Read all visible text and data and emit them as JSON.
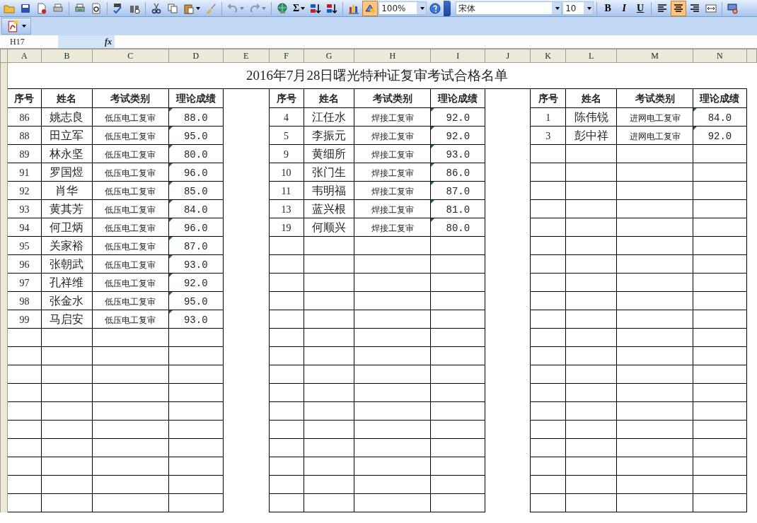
{
  "toolbar": [
    {
      "kind": "icon",
      "selected": false,
      "disabled": false,
      "dropdown": false
    },
    {
      "kind": "icon",
      "selected": false,
      "disabled": false,
      "dropdown": false
    },
    {
      "kind": "icon",
      "selected": false,
      "disabled": false,
      "dropdown": false
    },
    {
      "kind": "icon",
      "selected": false,
      "disabled": false,
      "dropdown": false
    },
    {
      "kind": "separator"
    },
    {
      "kind": "icon",
      "selected": false,
      "disabled": false,
      "dropdown": false
    },
    {
      "kind": "icon",
      "selected": false,
      "disabled": false,
      "dropdown": false
    },
    {
      "kind": "separator"
    },
    {
      "kind": "icon",
      "selected": false,
      "disabled": false,
      "dropdown": false
    },
    {
      "kind": "icon",
      "selected": false,
      "disabled": false,
      "dropdown": false
    },
    {
      "kind": "separator"
    },
    {
      "kind": "icon",
      "selected": false,
      "disabled": false,
      "dropdown": false
    },
    {
      "kind": "icon",
      "selected": false,
      "disabled": false,
      "dropdown": false
    },
    {
      "kind": "icon",
      "selected": false,
      "disabled": false,
      "dropdown": true
    },
    {
      "kind": "icon",
      "selected": false,
      "disabled": false,
      "dropdown": false
    },
    {
      "kind": "separator"
    },
    {
      "kind": "icon",
      "selected": false,
      "disabled": true,
      "dropdown": true
    },
    {
      "kind": "icon",
      "selected": false,
      "disabled": true,
      "dropdown": true
    },
    {
      "kind": "separator"
    },
    {
      "kind": "icon",
      "selected": false,
      "disabled": false,
      "dropdown": false
    },
    {
      "kind": "text",
      "text": "Σ",
      "bold": true,
      "italic": false,
      "underline": false,
      "selected": false,
      "disabled": false,
      "dropdown": true
    },
    {
      "kind": "icon",
      "selected": false,
      "disabled": false,
      "dropdown": false
    },
    {
      "kind": "icon",
      "selected": false,
      "disabled": false,
      "dropdown": false
    },
    {
      "kind": "separator"
    },
    {
      "kind": "icon",
      "selected": false,
      "disabled": false,
      "dropdown": false
    },
    {
      "kind": "icon",
      "selected": true,
      "disabled": false,
      "dropdown": false
    },
    {
      "kind": "combo",
      "value": "100%"
    },
    {
      "kind": "icon",
      "selected": false,
      "disabled": false,
      "dropdown": false
    },
    {
      "kind": "grip"
    },
    {
      "kind": "font_combo",
      "value": "宋体"
    },
    {
      "kind": "size_combo",
      "value": "10"
    },
    {
      "kind": "separator"
    },
    {
      "kind": "text",
      "text": "B",
      "bold": true,
      "italic": false,
      "underline": false,
      "selected": false,
      "disabled": false,
      "dropdown": false
    },
    {
      "kind": "text",
      "text": "I",
      "bold": true,
      "italic": true,
      "underline": false,
      "selected": false,
      "disabled": false,
      "dropdown": false
    },
    {
      "kind": "text",
      "text": "U",
      "bold": true,
      "italic": false,
      "underline": true,
      "selected": false,
      "disabled": false,
      "dropdown": false
    },
    {
      "kind": "separator"
    },
    {
      "kind": "icon",
      "selected": false,
      "disabled": false,
      "dropdown": false
    },
    {
      "kind": "icon",
      "selected": true,
      "disabled": false,
      "dropdown": false
    },
    {
      "kind": "icon",
      "selected": false,
      "disabled": false,
      "dropdown": false
    },
    {
      "kind": "icon",
      "selected": false,
      "disabled": false,
      "dropdown": false
    },
    {
      "kind": "separator"
    },
    {
      "kind": "icon",
      "selected": false,
      "disabled": false,
      "dropdown": false
    }
  ],
  "formula_bar": {
    "name_box": "H17",
    "function_label": "fx"
  },
  "column_headers": [
    "A",
    "B",
    "C",
    "D",
    "E",
    "F",
    "G",
    "H",
    "I",
    "J",
    "K",
    "L",
    "M",
    "N"
  ],
  "title": "2016年7月28日曙光特种证复审考试合格名单",
  "sections": [
    {
      "columns": [
        "序号",
        "姓名",
        "考试类别",
        "理论成绩"
      ],
      "rows": [
        {
          "no": "86",
          "name": "姚志良",
          "category": "低压电工复审",
          "score": "88.0",
          "flag": true
        },
        {
          "no": "88",
          "name": "田立军",
          "category": "低压电工复审",
          "score": "95.0",
          "flag": true
        },
        {
          "no": "89",
          "name": "林永坚",
          "category": "低压电工复审",
          "score": "80.0",
          "flag": true
        },
        {
          "no": "91",
          "name": "罗国煜",
          "category": "低压电工复审",
          "score": "96.0",
          "flag": true
        },
        {
          "no": "92",
          "name": "肖华",
          "category": "低压电工复审",
          "score": "85.0",
          "flag": true
        },
        {
          "no": "93",
          "name": "黄其芳",
          "category": "低压电工复审",
          "score": "84.0",
          "flag": true
        },
        {
          "no": "94",
          "name": "何卫炳",
          "category": "低压电工复审",
          "score": "96.0",
          "flag": true
        },
        {
          "no": "95",
          "name": "关家裕",
          "category": "低压电工复审",
          "score": "87.0",
          "flag": true
        },
        {
          "no": "96",
          "name": "张朝武",
          "category": "低压电工复审",
          "score": "93.0",
          "flag": true
        },
        {
          "no": "97",
          "name": "孔祥维",
          "category": "低压电工复审",
          "score": "92.0",
          "flag": true
        },
        {
          "no": "98",
          "name": "张金水",
          "category": "低压电工复审",
          "score": "95.0",
          "flag": true
        },
        {
          "no": "99",
          "name": "马启安",
          "category": "低压电工复审",
          "score": "93.0",
          "flag": true
        }
      ]
    },
    {
      "columns": [
        "序号",
        "姓名",
        "考试类别",
        "理论成绩"
      ],
      "rows": [
        {
          "no": "4",
          "name": "江任水",
          "category": "焊接工复审",
          "score": "92.0",
          "flag": true
        },
        {
          "no": "5",
          "name": "李振元",
          "category": "焊接工复审",
          "score": "92.0",
          "flag": true
        },
        {
          "no": "9",
          "name": "黄细所",
          "category": "焊接工复审",
          "score": "93.0",
          "flag": true
        },
        {
          "no": "10",
          "name": "张门生",
          "category": "焊接工复审",
          "score": "86.0",
          "flag": true
        },
        {
          "no": "11",
          "name": "韦明福",
          "category": "焊接工复审",
          "score": "87.0",
          "flag": true
        },
        {
          "no": "13",
          "name": "蓝兴根",
          "category": "焊接工复审",
          "score": "81.0",
          "flag": true
        },
        {
          "no": "19",
          "name": "何顺兴",
          "category": "焊接工复审",
          "score": "80.0",
          "flag": true
        }
      ]
    },
    {
      "columns": [
        "序号",
        "姓名",
        "考试类别",
        "理论成绩"
      ],
      "rows": [
        {
          "no": "1",
          "name": "陈伟锐",
          "category": "进网电工复审",
          "score": "84.0",
          "flag": true
        },
        {
          "no": "3",
          "name": "彭中祥",
          "category": "进网电工复审",
          "score": "92.0",
          "flag": true
        }
      ]
    }
  ]
}
